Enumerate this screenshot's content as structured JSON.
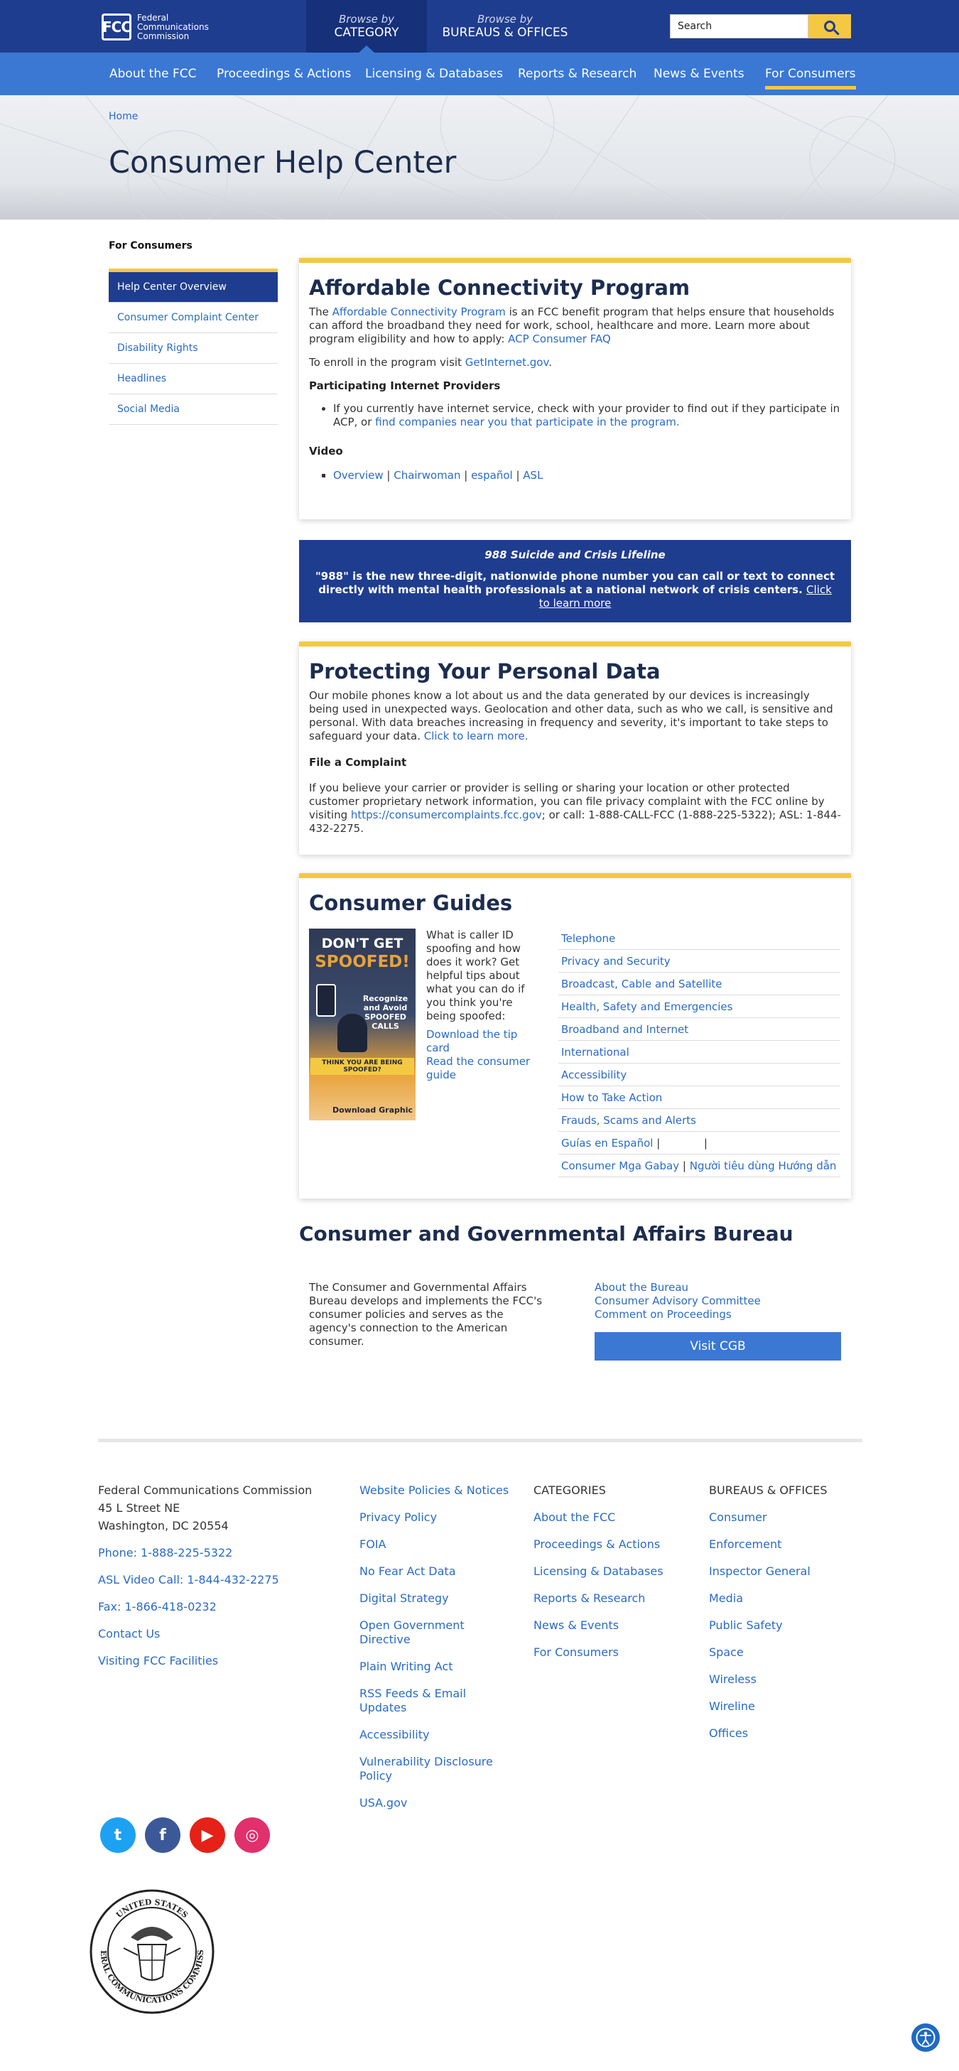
{
  "header": {
    "logo_text_lines": [
      "Federal",
      "Communications",
      "Commission"
    ],
    "logo_mark": "FCC",
    "browse_category_small": "Browse by",
    "browse_category_big": "Category",
    "browse_bureaus_small": "Browse by",
    "browse_bureaus_big": "Bureaus & Offices",
    "search_placeholder": "Search",
    "search_icon": "search-icon"
  },
  "nav": {
    "items": [
      "About the FCC",
      "Proceedings & Actions",
      "Licensing & Databases",
      "Reports & Research",
      "News & Events",
      "For Consumers"
    ],
    "active": "For Consumers"
  },
  "breadcrumb": "Home",
  "page_title": "Consumer Help Center",
  "sidebar": {
    "heading": "For Consumers",
    "items": [
      "Help Center Overview",
      "Consumer Complaint Center",
      "Disability Rights",
      "Headlines",
      "Social Media"
    ],
    "active": "Help Center Overview"
  },
  "acp": {
    "title": "Affordable Connectivity Program",
    "p1_pre": "The ",
    "p1_link": "Affordable Connectivity Program",
    "p1_mid": " is an FCC benefit program that helps ensure that households can afford the broadband they need for work, school, healthcare and more. Learn more about program eligibility and how to apply: ",
    "p1_link2": "ACP Consumer FAQ",
    "p2_pre": "To enroll in the program visit ",
    "p2_link": "GetInternet.gov",
    "p2_post": ".",
    "providers_heading": "Participating Internet Providers",
    "providers_text": "If you currently have internet service, check with your provider to find out if they participate in ACP, or ",
    "providers_link": "find companies near you that participate in the program.",
    "video_heading": "Video",
    "video_links": [
      "Overview",
      "Chairwoman",
      "español",
      "ASL"
    ]
  },
  "lifeline": {
    "title": "988 Suicide and Crisis Lifeline",
    "body": "\"988\" is the new three-digit, nationwide phone number you can call or text to connect directly with mental health professionals at a national network of crisis centers.",
    "link": "Click to learn more"
  },
  "personal_data": {
    "title": "Protecting Your Personal Data",
    "p1": "Our mobile phones know a lot about us and the data generated by our devices is increasingly being used in unexpected ways. Geolocation and other data, such as who we call, is sensitive and personal. With data breaches increasing in frequency and severity, it's important to take steps to safeguard your data. ",
    "p1_link": "Click to learn more.",
    "complaint_heading": "File a Complaint",
    "p2_pre": "If you believe your carrier or provider is selling or sharing your location or other protected customer proprietary network information, you can file privacy complaint with the FCC online by visiting ",
    "p2_link": "https://consumercomplaints.fcc.gov",
    "p2_post": "; or call: 1-888-CALL-FCC (1-888-225-5322); ASL: 1-844-432-2275."
  },
  "guides": {
    "title": "Consumer Guides",
    "poster_line1": "DON'T GET",
    "poster_line2": "SPOOFED!",
    "poster_line3": "Recognize and Avoid SPOOFED CALLS",
    "poster_line4": "THINK YOU ARE BEING SPOOFED?",
    "poster_line5": "Download Graphic",
    "desc": "What is caller ID spoofing and how does it work? Get helpful tips about what you can do if you think you're being spoofed:",
    "link1": "Download the tip card",
    "link2": "Read the consumer guide",
    "categories": [
      "Telephone",
      "Privacy and Security",
      "Broadcast, Cable and Satellite",
      "Health, Safety and Emergencies",
      "Broadband and Internet",
      "International",
      "Accessibility",
      "How to Take Action",
      "Frauds, Scams and Alerts"
    ],
    "lang_row1_link": "Guías en Español",
    "lang_row1_sep": "|",
    "lang_row1_sep2": "|",
    "lang_row2_link1": "Consumer Mga Gabay",
    "lang_row2_sep": "|",
    "lang_row2_link2": "Người tiêu dùng Hướng dẫn"
  },
  "cgb": {
    "title": "Consumer and Governmental Affairs Bureau",
    "text": "The Consumer and Governmental Affairs Bureau develops and implements the FCC's consumer policies and serves as the agency's connection to the American consumer.",
    "links": [
      "About the Bureau",
      "Consumer Advisory Committee",
      "Comment on Proceedings"
    ],
    "button": "Visit CGB"
  },
  "footer": {
    "address": [
      "Federal Communications Commission",
      "45 L Street NE",
      "Washington, DC 20554"
    ],
    "contact": [
      "Phone: 1-888-225-5322",
      "ASL Video Call: 1-844-432-2275",
      "Fax: 1-866-418-0232",
      "Contact Us",
      "Visiting FCC Facilities"
    ],
    "policies": [
      "Website Policies & Notices",
      "Privacy Policy",
      "FOIA",
      "No Fear Act Data",
      "Digital Strategy",
      "Open Government Directive",
      "Plain Writing Act",
      "RSS Feeds & Email Updates",
      "Accessibility",
      "Vulnerability Disclosure Policy",
      "USA.gov"
    ],
    "categories_heading": "CATEGORIES",
    "categories": [
      "About the FCC",
      "Proceedings & Actions",
      "Licensing & Databases",
      "Reports & Research",
      "News & Events",
      "For Consumers"
    ],
    "bureaus_heading": "BUREAUS & OFFICES",
    "bureaus": [
      "Consumer",
      "Enforcement",
      "Inspector General",
      "Media",
      "Public Safety",
      "Space",
      "Wireless",
      "Wireline",
      "Offices"
    ],
    "social": [
      {
        "name": "twitter-icon",
        "glyph": "t",
        "color": "#1da1f2"
      },
      {
        "name": "facebook-icon",
        "glyph": "f",
        "color": "#3b5998"
      },
      {
        "name": "youtube-icon",
        "glyph": "▶",
        "color": "#e62117"
      },
      {
        "name": "instagram-icon",
        "glyph": "◎",
        "color": "#e1306c"
      }
    ],
    "seal_top_text": "UNITED STATES",
    "seal_bottom_text": "FEDERAL COMMUNICATIONS COMMISSION"
  },
  "colors": {
    "navy": "#1f3d8f",
    "blue": "#3a78d4",
    "gold": "#f5c842",
    "link": "#2a6bc6"
  }
}
